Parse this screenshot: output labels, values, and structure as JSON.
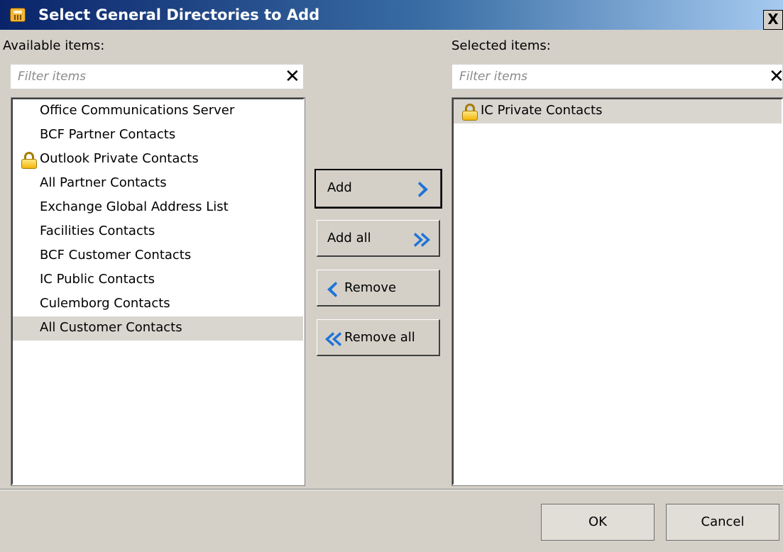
{
  "window": {
    "title": "Select General Directories to Add",
    "close_label": "X",
    "app_icon": "phone-icon"
  },
  "available": {
    "label": "Available items:",
    "filter_placeholder": "Filter items",
    "clear_label": "✕",
    "items": [
      {
        "label": "Office Communications Server",
        "locked": false,
        "selected": false
      },
      {
        "label": "BCF Partner Contacts",
        "locked": false,
        "selected": false
      },
      {
        "label": "Outlook Private Contacts",
        "locked": true,
        "selected": false
      },
      {
        "label": "All Partner Contacts",
        "locked": false,
        "selected": false
      },
      {
        "label": "Exchange Global Address List",
        "locked": false,
        "selected": false
      },
      {
        "label": "Facilities Contacts",
        "locked": false,
        "selected": false
      },
      {
        "label": "BCF Customer Contacts",
        "locked": false,
        "selected": false
      },
      {
        "label": "IC Public Contacts",
        "locked": false,
        "selected": false
      },
      {
        "label": "Culemborg Contacts",
        "locked": false,
        "selected": false
      },
      {
        "label": "All Customer Contacts",
        "locked": false,
        "selected": true
      }
    ]
  },
  "selected": {
    "label": "Selected items:",
    "filter_placeholder": "Filter items",
    "clear_label": "✕",
    "items": [
      {
        "label": "IC Private Contacts",
        "locked": true,
        "selected": true
      }
    ]
  },
  "actions": {
    "add": "Add",
    "add_all": "Add all",
    "remove": "Remove",
    "remove_all": "Remove all"
  },
  "footer": {
    "ok": "OK",
    "cancel": "Cancel"
  },
  "colors": {
    "arrow_blue": "#1e73d8",
    "selected_row": "#d9d6d0",
    "dialog_bg": "#d4d0c8"
  }
}
